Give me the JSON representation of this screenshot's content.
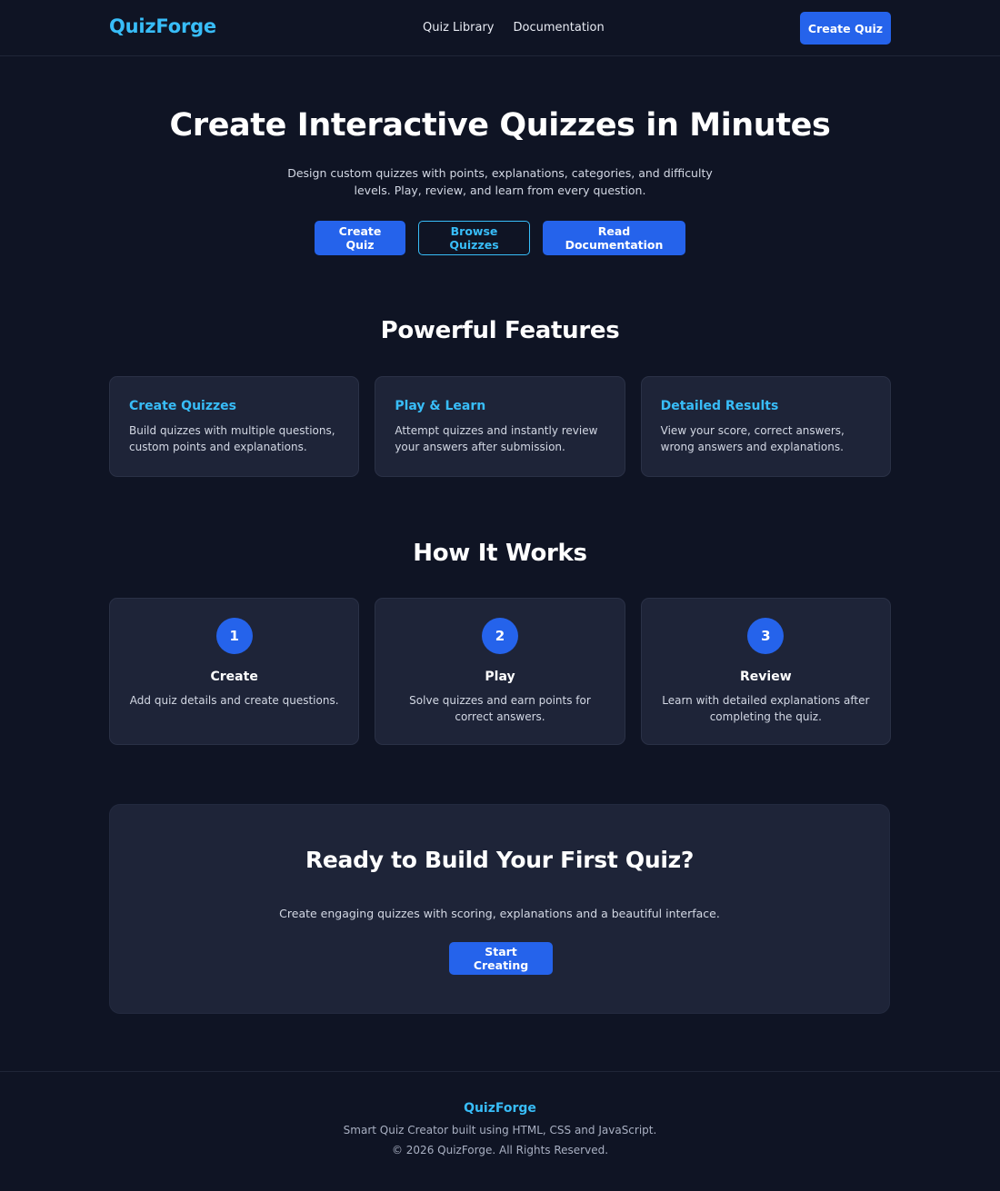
{
  "header": {
    "brand": "QuizForge",
    "nav": [
      "Quiz Library",
      "Documentation"
    ],
    "cta_label": "Create Quiz"
  },
  "hero": {
    "title": "Create Interactive Quizzes in Minutes",
    "subtitle": "Design custom quizzes with points, explanations, categories, and difficulty levels. Play, review, and learn from every question.",
    "buttons": {
      "create": "Create Quiz",
      "browse": "Browse Quizzes",
      "docs": "Read Documentation"
    }
  },
  "features": {
    "title": "Powerful Features",
    "items": [
      {
        "title": "Create Quizzes",
        "desc": "Build quizzes with multiple questions, custom points and explanations."
      },
      {
        "title": "Play & Learn",
        "desc": "Attempt quizzes and instantly review your answers after submission."
      },
      {
        "title": "Detailed Results",
        "desc": "View your score, correct answers, wrong answers and explanations."
      }
    ]
  },
  "how_it_works": {
    "title": "How It Works",
    "steps": [
      {
        "num": "1",
        "title": "Create",
        "desc": "Add quiz details and create questions."
      },
      {
        "num": "2",
        "title": "Play",
        "desc": "Solve quizzes and earn points for correct answers."
      },
      {
        "num": "3",
        "title": "Review",
        "desc": "Learn with detailed explanations after completing the quiz."
      }
    ]
  },
  "cta": {
    "title": "Ready to Build Your First Quiz?",
    "desc": "Create engaging quizzes with scoring, explanations and a beautiful interface.",
    "button": "Start Creating"
  },
  "footer": {
    "brand": "QuizForge",
    "tagline": "Smart Quiz Creator built using HTML, CSS and JavaScript.",
    "copyright": "© 2026 QuizForge. All Rights Reserved."
  },
  "colors": {
    "background": "#0f1424",
    "card": "#1e2438",
    "accent": "#38bdf8",
    "primary": "#2563eb"
  }
}
